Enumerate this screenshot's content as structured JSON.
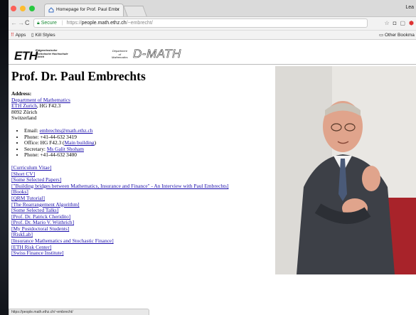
{
  "browser": {
    "tab_title": "Homepage for Prof. Paul Embr",
    "profile_name": "Lea",
    "secure_label": "Secure",
    "url_scheme": "https://",
    "url_host": "people.math.ethz.ch",
    "url_path": "/~embrecht/",
    "bookmarks": {
      "apps": "Apps",
      "kill_styles": "Kill Styles",
      "other": "Other Bookma"
    },
    "status_url": "https://people.math.ethz.ch/~embrecht/"
  },
  "header": {
    "logo": "ETH",
    "logo_sub_1": "Eidgenössische",
    "logo_sub_2": "Technische Hochschule",
    "logo_sub_3": "Zürich",
    "dept_1": "Department",
    "dept_2": "of",
    "dept_3": "Mathematics",
    "dept_logo": "D-MATH"
  },
  "page": {
    "title": "Prof. Dr. Paul Embrechts",
    "address_label": "Address:",
    "address_dept_link": "Department of Mathematics",
    "address_eth_link": "ETH Zurich",
    "address_eth_rest": ", HG F42.3",
    "address_city": "8092 Zürich",
    "address_country": "Switzerland",
    "contacts": {
      "email_label": "Email: ",
      "email": "embrechts@math.ethz.ch",
      "phone_label": "Phone: +41-44-632 3419",
      "office_label": "Office: HG F42.3 (",
      "office_link": "Main building",
      "office_end": ")",
      "secretary_label": "Secretary: ",
      "secretary_link": "Ms Galit Shoham",
      "phone2_label": "Phone: +41-44-632 3400"
    },
    "links": [
      "[Curriculum Vitae]",
      "[Short CV]",
      "[Some Selected Papers]",
      "[\"Building bridges between Mathematics, Insurance and Finance\" - An Interview with Paul Embrechts]",
      "[Books]",
      "[QRM Tutorial]",
      "[The Rearrangement Algorithm]",
      "[Some Selected Talks]",
      "[Prof. Dr. Patrick Cheridito]",
      "[Prof. Dr. Mario V. Wüthrich]",
      "[My Postdoctoral Students]",
      "[RiskLab]",
      "[Insurance Mathematics and Stochastic Finance]",
      "[ETH Risk Center]",
      "[Swiss Finance Institute]"
    ]
  }
}
